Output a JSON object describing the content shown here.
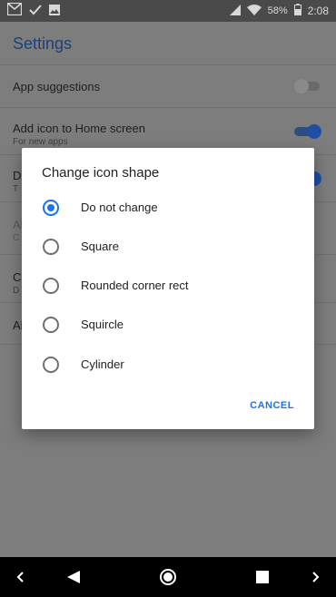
{
  "status_bar": {
    "battery": "58%",
    "time": "2:08",
    "icons": [
      "gmail-icon",
      "check-icon",
      "image-icon",
      "signal-icon",
      "wifi-icon",
      "battery-icon"
    ]
  },
  "settings": {
    "title": "Settings",
    "rows": [
      {
        "title": "App suggestions",
        "subtitle": "",
        "toggle": "off"
      },
      {
        "title": "Add icon to Home screen",
        "subtitle": "For new apps",
        "toggle": "on"
      },
      {
        "title": "D",
        "subtitle": "T",
        "toggle": "on"
      },
      {
        "title": "Al",
        "subtitle": "C",
        "toggle": ""
      },
      {
        "title": "Ch",
        "subtitle": "D",
        "toggle": ""
      },
      {
        "title": "Al",
        "subtitle": "",
        "toggle": ""
      }
    ]
  },
  "dialog": {
    "title": "Change icon shape",
    "options": [
      {
        "label": "Do not change",
        "selected": true
      },
      {
        "label": "Square",
        "selected": false
      },
      {
        "label": "Rounded corner rect",
        "selected": false
      },
      {
        "label": "Squircle",
        "selected": false
      },
      {
        "label": "Cylinder",
        "selected": false
      }
    ],
    "cancel_label": "CANCEL"
  },
  "colors": {
    "accent": "#1a73e8",
    "scrim_background": "#7d7d7d",
    "navbar": "#000000"
  }
}
